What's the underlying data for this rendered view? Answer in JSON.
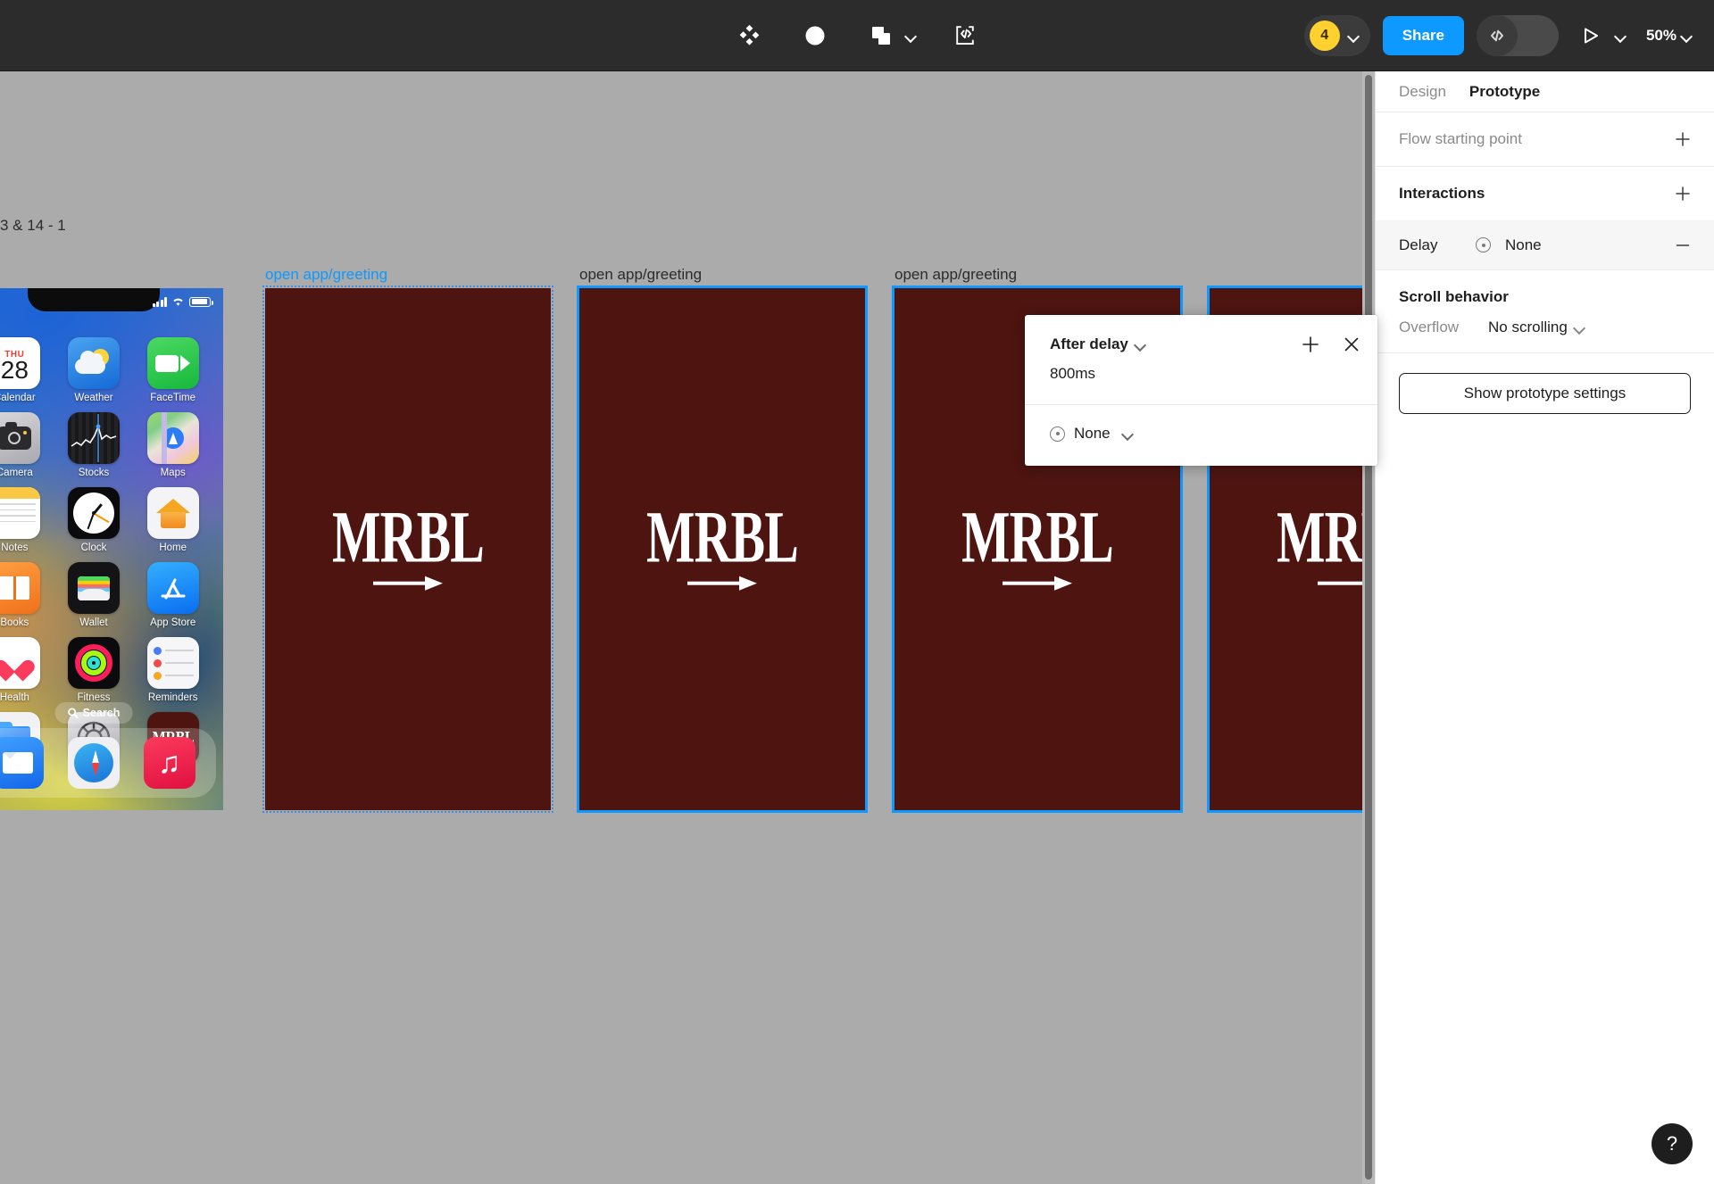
{
  "app": {
    "name": "Figma"
  },
  "toolbar": {
    "tools": [
      {
        "name": "components-icon",
        "label": "Components"
      },
      {
        "name": "contrast-icon",
        "label": "Contrast"
      },
      {
        "name": "boolean-union-icon",
        "label": "Boolean groups"
      },
      {
        "name": "code-frame-icon",
        "label": "Code block"
      }
    ],
    "boolean_caret": "▾",
    "collaborator_count": "4",
    "collaborators_caret": "▾",
    "share_label": "Share",
    "devmode_icon": "</>",
    "present_caret": "▾",
    "zoom_level": "50%",
    "zoom_caret": "▾",
    "accent_color": "#0d99ff",
    "avatar_color": "#ffd12e",
    "background_color": "#2c2c2c"
  },
  "canvas": {
    "background_color": "#ababab",
    "frame_fill": "#4d1410",
    "selection_color": "#0d99ff",
    "partial_page_label": "3 & 14 - 1",
    "frames": [
      {
        "label": "open app/greeting",
        "label_accent": true,
        "selection": "dotted",
        "logo": "MRBL"
      },
      {
        "label": "open app/greeting",
        "label_accent": false,
        "selection": "solid",
        "logo": "MRBL"
      },
      {
        "label": "open app/greeting",
        "label_accent": false,
        "selection": "solid",
        "logo": "MRBL"
      },
      {
        "label": "",
        "label_accent": false,
        "selection": "solid",
        "logo": "MRBL"
      }
    ],
    "ios_home": {
      "status": {
        "signal": "signal-bars-icon",
        "wifi": "wifi-icon",
        "battery": "battery-icon"
      },
      "apps": [
        {
          "name": "Calendar",
          "icon": "calendar-icon",
          "day_of_week": "THU",
          "day": "28"
        },
        {
          "name": "Weather",
          "icon": "weather-icon"
        },
        {
          "name": "FaceTime",
          "icon": "facetime-icon"
        },
        {
          "name": "Camera",
          "icon": "camera-icon"
        },
        {
          "name": "Stocks",
          "icon": "stocks-icon"
        },
        {
          "name": "Maps",
          "icon": "maps-icon"
        },
        {
          "name": "Notes",
          "icon": "notes-icon"
        },
        {
          "name": "Clock",
          "icon": "clock-icon"
        },
        {
          "name": "Home",
          "icon": "home-icon"
        },
        {
          "name": "Books",
          "icon": "books-icon"
        },
        {
          "name": "Wallet",
          "icon": "wallet-icon"
        },
        {
          "name": "App Store",
          "icon": "app-store-icon"
        },
        {
          "name": "Health",
          "icon": "health-icon"
        },
        {
          "name": "Fitness",
          "icon": "fitness-icon"
        },
        {
          "name": "Reminders",
          "icon": "reminders-icon"
        },
        {
          "name": "Files",
          "icon": "files-icon"
        },
        {
          "name": "Settings",
          "icon": "settings-icon"
        },
        {
          "name": "MRBL",
          "icon": "mrbl-icon",
          "glyph": "MRBL"
        }
      ],
      "search_label": "Search",
      "dock": [
        {
          "name": "Mail",
          "icon": "mail-icon"
        },
        {
          "name": "Safari",
          "icon": "safari-icon"
        },
        {
          "name": "Music",
          "icon": "music-icon"
        }
      ]
    }
  },
  "interaction_popup": {
    "trigger_label": "After delay",
    "trigger_caret": "▾",
    "delay_value": "800ms",
    "add_label": "+",
    "close_label": "×",
    "action_label": "None",
    "action_caret": "▾"
  },
  "right_panel": {
    "tabs": [
      {
        "label": "Design",
        "active": false
      },
      {
        "label": "Prototype",
        "active": true
      }
    ],
    "flow_starting_point": {
      "title": "Flow starting point",
      "add": "+"
    },
    "interactions": {
      "title": "Interactions",
      "add": "+"
    },
    "delay_row": {
      "label": "Delay",
      "value": "None",
      "remove": "−"
    },
    "scroll_behavior": {
      "title": "Scroll behavior",
      "overflow_label": "Overflow",
      "overflow_value": "No scrolling",
      "overflow_caret": "▾"
    },
    "show_prototype_settings": "Show prototype settings"
  },
  "help": {
    "label": "?"
  }
}
